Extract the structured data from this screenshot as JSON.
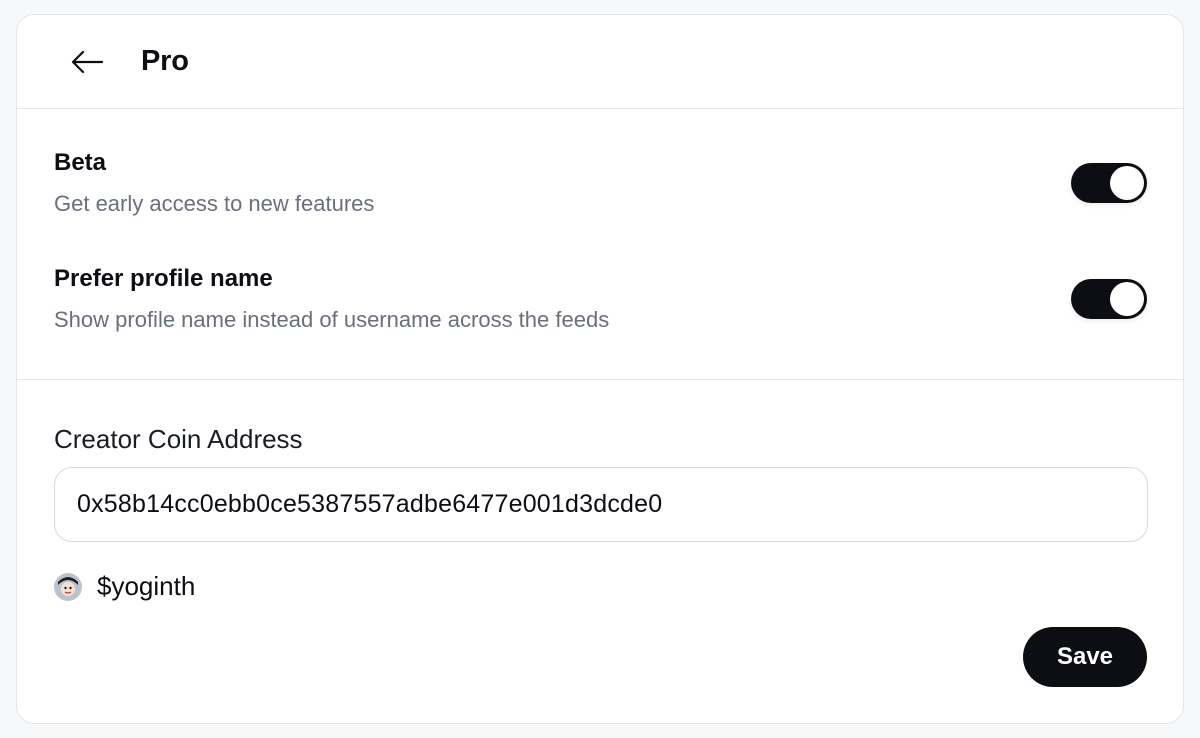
{
  "header": {
    "back_icon": "arrow-left-icon",
    "title": "Pro"
  },
  "settings": [
    {
      "title": "Beta",
      "description": "Get early access to new features",
      "enabled": true
    },
    {
      "title": "Prefer profile name",
      "description": "Show profile name instead of username across the feeds",
      "enabled": true
    }
  ],
  "creator_coin": {
    "label": "Creator Coin Address",
    "value": "0x58b14cc0ebb0ce5387557adbe6477e001d3dcde0",
    "ticker": "$yoginth",
    "avatar_icon": "avatar-icon"
  },
  "actions": {
    "save_label": "Save"
  },
  "colors": {
    "primary": "#0c0e14",
    "muted_text": "#6a6f7c",
    "border": "#e6e8ec",
    "background": "#f7f8fa"
  }
}
